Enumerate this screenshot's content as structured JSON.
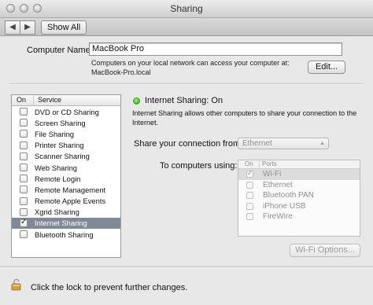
{
  "window": {
    "title": "Sharing"
  },
  "toolbar": {
    "back": "◀",
    "forward": "▶",
    "show_all": "Show All"
  },
  "computer_name": {
    "label": "Computer Name:",
    "value": "MacBook Pro",
    "hint_line1": "Computers on your local network can access your computer at:",
    "hint_line2": "MacBook-Pro.local",
    "edit_button": "Edit..."
  },
  "services": {
    "col_on": "On",
    "col_service": "Service",
    "items": [
      {
        "label": "DVD or CD Sharing",
        "checked": false
      },
      {
        "label": "Screen Sharing",
        "checked": false
      },
      {
        "label": "File Sharing",
        "checked": false
      },
      {
        "label": "Printer Sharing",
        "checked": false
      },
      {
        "label": "Scanner Sharing",
        "checked": false
      },
      {
        "label": "Web Sharing",
        "checked": false
      },
      {
        "label": "Remote Login",
        "checked": false
      },
      {
        "label": "Remote Management",
        "checked": false
      },
      {
        "label": "Remote Apple Events",
        "checked": false
      },
      {
        "label": "Xgrid Sharing",
        "checked": false
      },
      {
        "label": "Internet Sharing",
        "checked": true,
        "selected": true
      },
      {
        "label": "Bluetooth Sharing",
        "checked": false
      }
    ]
  },
  "detail": {
    "status": "Internet Sharing: On",
    "status_color": "#3aa61f",
    "desc_line1": "Internet Sharing allows other computers to share your connection to the",
    "desc_line2": "Internet.",
    "share_from_label": "Share your connection from:",
    "share_from_value": "Ethernet",
    "to_computers_label": "To computers using:",
    "ports_col_on": "On",
    "ports_col_ports": "Ports",
    "ports": [
      {
        "label": "Wi-Fi",
        "checked": true
      },
      {
        "label": "Ethernet",
        "checked": false
      },
      {
        "label": "Bluetooth PAN",
        "checked": false
      },
      {
        "label": "iPhone USB",
        "checked": false
      },
      {
        "label": "FireWire",
        "checked": false
      }
    ],
    "wifi_options_button": "Wi-Fi Options..."
  },
  "footer": {
    "lock_text": "Click the lock to prevent further changes."
  },
  "icons": {
    "lock": "lock-open-icon",
    "status": "status-dot-icon"
  }
}
